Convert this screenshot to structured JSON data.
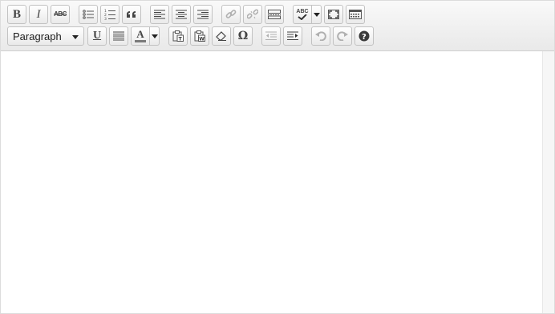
{
  "toolbar": {
    "row1": {
      "bold": "B",
      "italic": "I",
      "strikethrough": "ABC",
      "spellcheck_label": "ABC"
    },
    "row2": {
      "format_select": "Paragraph",
      "underline": "U",
      "text_color": "A",
      "special_char": "Ω"
    }
  },
  "icons": [
    "bold-icon",
    "italic-icon",
    "strikethrough-icon",
    "bullet-list-icon",
    "numbered-list-icon",
    "blockquote-icon",
    "align-left-icon",
    "align-center-icon",
    "align-right-icon",
    "link-icon",
    "unlink-icon",
    "read-more-icon",
    "spellcheck-icon",
    "fullscreen-icon",
    "kitchen-sink-icon",
    "underline-icon",
    "justify-icon",
    "text-color-icon",
    "paste-text-icon",
    "paste-word-icon",
    "clear-formatting-icon",
    "special-char-icon",
    "outdent-icon",
    "indent-icon",
    "undo-icon",
    "redo-icon",
    "help-icon"
  ],
  "colors": {
    "toolbar_bg": "#eeeeee",
    "text_color_swatch": "#7a7a7a"
  }
}
